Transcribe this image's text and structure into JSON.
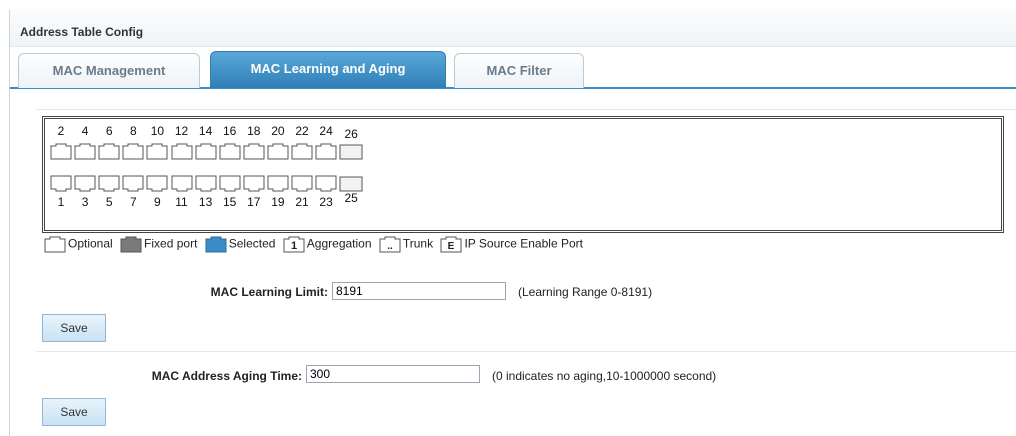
{
  "header": {
    "title": "Address Table Config"
  },
  "tabs": [
    {
      "label": "MAC Management",
      "active": false
    },
    {
      "label": "MAC Learning and Aging",
      "active": true
    },
    {
      "label": "MAC Filter",
      "active": false
    }
  ],
  "ports": {
    "top_row": [
      "2",
      "4",
      "6",
      "8",
      "10",
      "12",
      "14",
      "16",
      "18",
      "20",
      "22",
      "24",
      "26"
    ],
    "bottom_row": [
      "1",
      "3",
      "5",
      "7",
      "9",
      "11",
      "13",
      "15",
      "17",
      "19",
      "21",
      "23",
      "25"
    ]
  },
  "legend": {
    "optional": "Optional",
    "fixed": "Fixed port",
    "selected": "Selected",
    "aggregation": "Aggregation",
    "aggregation_icon_text": "1",
    "trunk": "Trunk",
    "trunk_icon_text": "..",
    "ip_source": "IP Source Enable Port",
    "ip_source_icon_text": "E"
  },
  "learning": {
    "label": "MAC Learning Limit:",
    "value": "8191",
    "hint": "(Learning Range 0-8191)",
    "save_label": "Save"
  },
  "aging": {
    "label": "MAC Address Aging Time:",
    "value": "300",
    "hint": "(0 indicates no aging,10-1000000 second)",
    "save_label": "Save"
  },
  "colors": {
    "tab_active": "#3a8cc4",
    "selected_port": "#3a8cc4",
    "fixed_port": "#7a7a7a"
  }
}
